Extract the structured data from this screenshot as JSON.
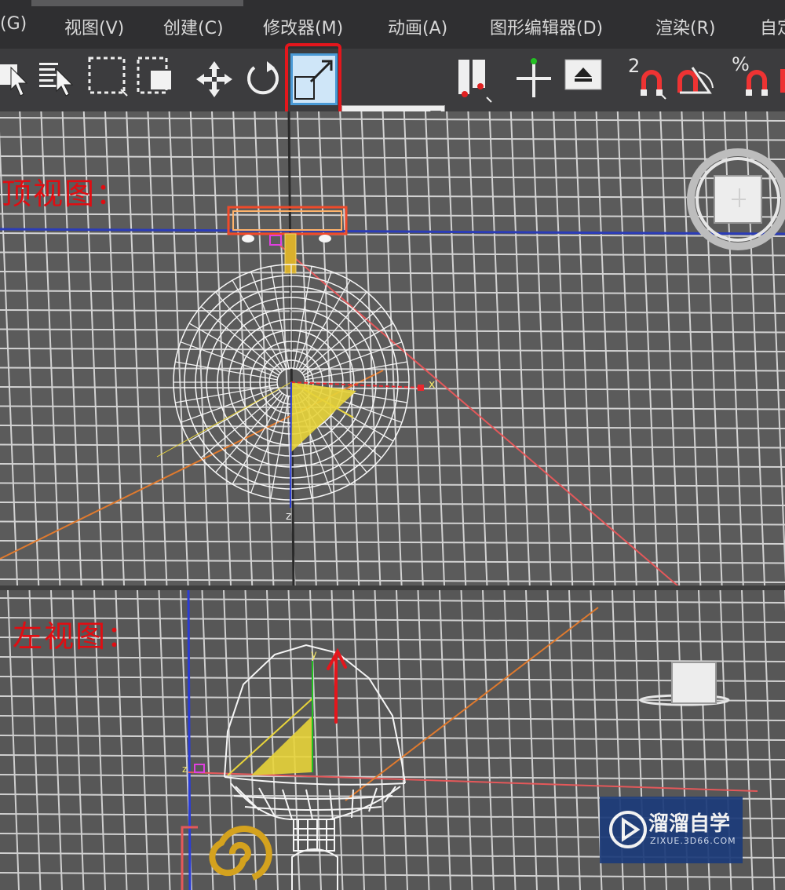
{
  "menu": {
    "items": [
      "(G)",
      "视图(V)",
      "创建(C)",
      "修改器(M)",
      "动画(A)",
      "图形编辑器(D)",
      "渲染(R)",
      "自定"
    ]
  },
  "toolbar": {
    "view_dropdown": "视图",
    "snap_2": "2",
    "snap_percent": "%",
    "highlighted_tool": "scale-tool",
    "highlight_color": "#e4161c"
  },
  "viewports": {
    "top": {
      "label": "顶视图："
    },
    "left": {
      "label": "左视图："
    }
  },
  "axes": {
    "x": "x",
    "z": "z",
    "y": "y"
  },
  "watermark": {
    "name": "溜溜自学",
    "url": "ZIXUE.3D66.COM"
  }
}
